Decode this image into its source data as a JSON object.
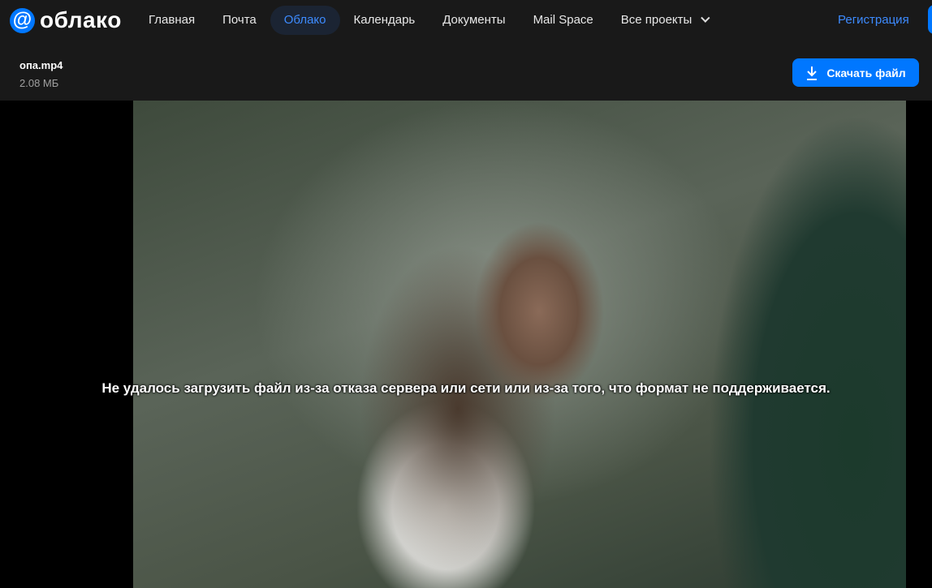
{
  "header": {
    "logo_symbol": "@",
    "logo_text": "облако",
    "nav": [
      "Главная",
      "Почта",
      "Облако",
      "Календарь",
      "Документы",
      "Mail Space",
      "Все проекты"
    ],
    "register": "Регистрация"
  },
  "file": {
    "name": "опа.mp4",
    "size": "2.08 МБ",
    "download_label": "Скачать файл"
  },
  "player": {
    "error": "Не удалось загрузить файл из-за отказа сервера или сети или из-за того, что формат не поддерживается."
  },
  "colors": {
    "accent": "#0077ff",
    "background": "#191919"
  }
}
